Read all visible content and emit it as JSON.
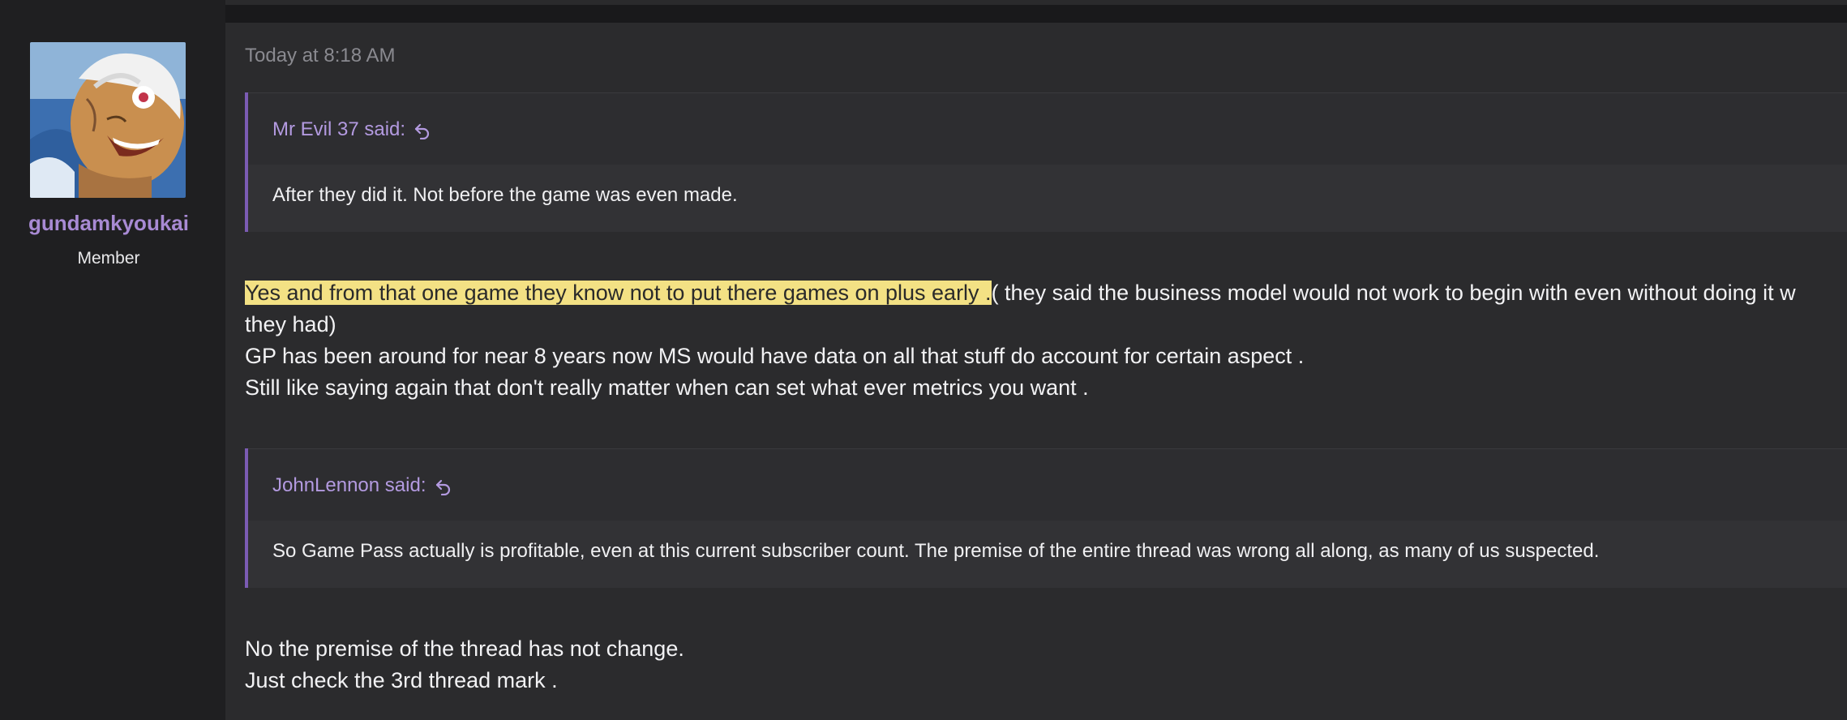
{
  "user": {
    "name": "gundamkyoukai",
    "role": "Member"
  },
  "post": {
    "date": "Today at 8:18 AM",
    "quote1": {
      "author": "Mr Evil 37 said:",
      "text": "After they did it. Not before the game was even made."
    },
    "reply1": {
      "highlight": "Yes and from that one game they know not to put there games on plus early .",
      "rest": "( they said the business model would not work to begin with even without doing it w",
      "line2": "they had)",
      "line3": "GP has been around for near 8 years now MS would have data on all that stuff do account for certain aspect .",
      "line4": "Still like saying again that don't really matter when can set what ever metrics you want ."
    },
    "quote2": {
      "author": "JohnLennon said:",
      "text": "So Game Pass actually is profitable, even at this current subscriber count. The premise of the entire thread was wrong all along, as many of us suspected."
    },
    "reply2": {
      "line1": "No the premise of the thread has not change.",
      "line2": "Just check the 3rd thread mark ."
    }
  },
  "colors": {
    "accent": "#a88ad4",
    "quote_border": "#7b5bb3",
    "highlight": "#f3e184"
  },
  "icons": {
    "reply": "reply-arrow-icon"
  }
}
